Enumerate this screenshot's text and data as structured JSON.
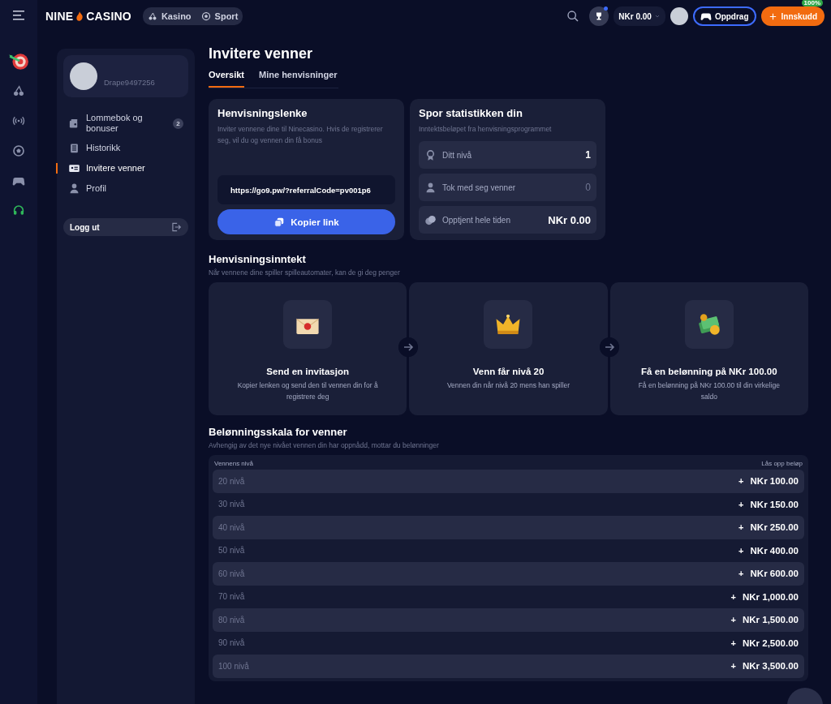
{
  "top_bar": {
    "logo_left": "NINE",
    "logo_right": "CASINO",
    "nav": [
      {
        "label": "Kasino"
      },
      {
        "label": "Sport"
      }
    ],
    "trophy_notification": true,
    "balance": "NKr 0.00",
    "quests_button": "Oppdrag",
    "deposit_button": "Innskudd",
    "deposit_badge": "100%"
  },
  "sidebar": {
    "username": "Drape9497256",
    "items": [
      {
        "label": "Lommebok og bonuser",
        "badge": "2",
        "selected": false
      },
      {
        "label": "Historikk",
        "selected": false
      },
      {
        "label": "Invitere venner",
        "selected": true
      },
      {
        "label": "Profil",
        "selected": false
      }
    ],
    "logout": "Logg ut"
  },
  "page": {
    "title": "Invitere venner",
    "tabs": [
      {
        "label": "Oversikt",
        "selected": true
      },
      {
        "label": "Mine henvisninger",
        "selected": false
      }
    ]
  },
  "referral_link": {
    "title": "Henvisningslenke",
    "description": "Inviter vennene dine til Ninecasino. Hvis de registrerer seg, vil du og vennen din få bonus",
    "link": "https://go9.pw/?referralCode=pv001p6",
    "copy_button": "Kopier link"
  },
  "stats": {
    "title": "Spor statistikken din",
    "subtitle": "Inntektsbeløpet fra henvisningsprogrammet",
    "rows": [
      {
        "kind": "level",
        "label": "Ditt nivå",
        "value": "1"
      },
      {
        "kind": "count",
        "label": "Tok med seg venner",
        "value": "0"
      },
      {
        "kind": "amount",
        "label": "Opptjent hele tiden",
        "value": "NKr 0.00"
      }
    ]
  },
  "income": {
    "title": "Henvisningsinntekt",
    "subtitle": "Når vennene dine spiller spilleautomater, kan de gi deg penger",
    "steps": [
      {
        "title": "Send en invitasjon",
        "description": "Kopier lenken og send den til vennen din for å registrere deg"
      },
      {
        "title": "Venn får nivå 20",
        "description": "Vennen din når nivå 20 mens han spiller"
      },
      {
        "title": "Få en belønning på NKr 100.00",
        "description": "Få en belønning på NKr 100.00 til din virkelige saldo"
      }
    ]
  },
  "scale": {
    "title": "Belønningsskala for venner",
    "subtitle": "Avhengig av det nye nivået vennen din har oppnådd, mottar du belønninger",
    "columns": [
      "Vennens nivå",
      "Lås opp beløp"
    ],
    "rows": [
      {
        "level": "20 nivå",
        "sign": "+",
        "amount": "NKr 100.00"
      },
      {
        "level": "30 nivå",
        "sign": "+",
        "amount": "NKr 150.00"
      },
      {
        "level": "40 nivå",
        "sign": "+",
        "amount": "NKr 250.00"
      },
      {
        "level": "50 nivå",
        "sign": "+",
        "amount": "NKr 400.00"
      },
      {
        "level": "60 nivå",
        "sign": "+",
        "amount": "NKr 600.00"
      },
      {
        "level": "70 nivå",
        "sign": "+",
        "amount": "NKr 1,000.00"
      },
      {
        "level": "80 nivå",
        "sign": "+",
        "amount": "NKr 1,500.00"
      },
      {
        "level": "90 nivå",
        "sign": "+",
        "amount": "NKr 2,500.00"
      },
      {
        "level": "100 nivå",
        "sign": "+",
        "amount": "NKr 3,500.00"
      }
    ]
  }
}
